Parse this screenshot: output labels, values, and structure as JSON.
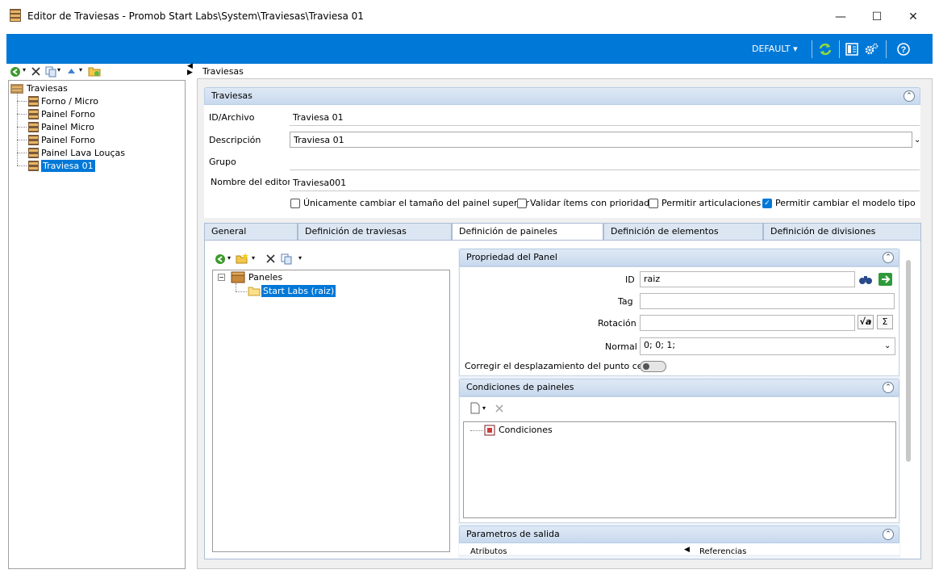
{
  "window": {
    "title": "Editor de Traviesas - Promob Start Labs\\System\\Traviesas\\Traviesa 01",
    "minimize": "—",
    "maximize": "☐",
    "close": "✕"
  },
  "toolbar": {
    "profile_label": "DEFAULT ▾"
  },
  "left_tree": {
    "root": "Traviesas",
    "items": [
      "Forno / Micro",
      "Painel Forno",
      "Painel Micro",
      "Painel Forno",
      "Painel Lava Louças",
      "Traviesa 01"
    ],
    "selected_index": 5
  },
  "breadcrumb": "Traviesas",
  "traviesas_section": {
    "header": "Traviesas",
    "fields": [
      {
        "label": "ID/Archivo",
        "value": "Traviesa 01"
      },
      {
        "label": "Descripción",
        "value": "Traviesa 01"
      },
      {
        "label": "Grupo",
        "value": ""
      },
      {
        "label": "Nombre del editor",
        "value": "Traviesa001"
      }
    ],
    "checkboxes": [
      {
        "label": "Únicamente cambiar el tamaño del painel superior",
        "checked": false
      },
      {
        "label": "Validar ítems con prioridad",
        "checked": false
      },
      {
        "label": "Permitir articulaciones",
        "checked": false
      },
      {
        "label": "Permitir cambiar el modelo tipo",
        "checked": true
      }
    ]
  },
  "tabs": [
    {
      "label": "General",
      "active": false
    },
    {
      "label": "Definición de traviesas",
      "active": false
    },
    {
      "label": "Definición de paineles",
      "active": true
    },
    {
      "label": "Definición de elementos",
      "active": false
    },
    {
      "label": "Definición de divisiones",
      "active": false
    }
  ],
  "panel_tree": {
    "root": "Paneles",
    "child": "Start Labs (raiz)"
  },
  "panel_props": {
    "header": "Propriedad del Panel",
    "id_label": "ID",
    "id_value": "raiz",
    "tag_label": "Tag",
    "tag_value": "",
    "rotation_label": "Rotación",
    "rotation_value": "",
    "normal_label": "Normal",
    "normal_value": "0; 0; 1;",
    "zero_label": "Corregir el desplazamiento del punto cero",
    "zero_on": false
  },
  "conditions": {
    "header": "Condiciones de paineles",
    "item": "Condiciones"
  },
  "output_params": {
    "header": "Parametros de salida",
    "attributes": "Atributos",
    "references": "Referencias"
  },
  "colors": {
    "accent": "#0078d7",
    "header_bg": "#c8d9ee",
    "tab_bg": "#dce6f2"
  }
}
